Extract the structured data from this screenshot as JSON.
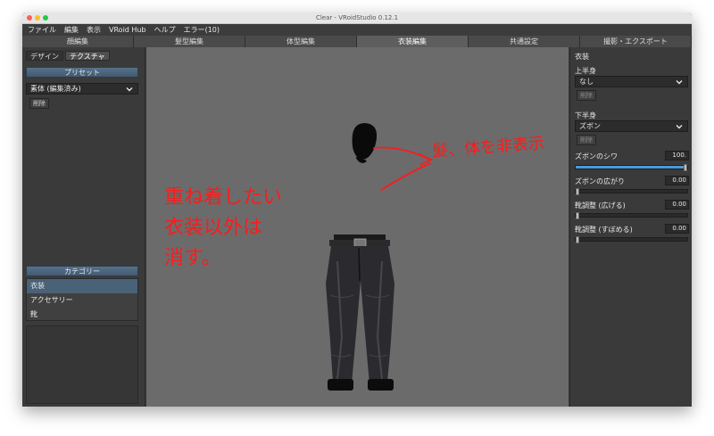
{
  "window": {
    "title": "Clear - VRoidStudio 0.12.1"
  },
  "menubar": [
    "ファイル",
    "編集",
    "表示",
    "VRoid Hub",
    "ヘルプ",
    "エラー(10)"
  ],
  "main_tabs": [
    "顔編集",
    "髪型編集",
    "体型編集",
    "衣装編集",
    "共通設定",
    "撮影・エクスポート"
  ],
  "active_main_tab": 3,
  "left": {
    "subtabs": [
      "デザイン",
      "テクスチャ"
    ],
    "preset_header": "プリセット",
    "preset_value": "素体 (編集済み)",
    "delete_label": "削除",
    "category_header": "カテゴリー",
    "categories": [
      "衣装",
      "アクセサリー",
      "靴"
    ]
  },
  "right": {
    "title": "衣装",
    "upper_label": "上半身",
    "upper_value": "なし",
    "upper_delete": "削除",
    "lower_label": "下半身",
    "lower_value": "ズボン",
    "lower_delete": "削除",
    "params": [
      {
        "label": "ズボンのシワ",
        "value": "100.",
        "fraction": 1.0
      },
      {
        "label": "ズボンの広がり",
        "value": "0.00",
        "fraction": 0.0
      },
      {
        "label": "靴調整 (広げる)",
        "value": "0.00",
        "fraction": 0.0
      },
      {
        "label": "靴調整 (すぼめる)",
        "value": "0.00",
        "fraction": 0.0
      }
    ]
  },
  "annotations": {
    "right_note": "髪、体を非表示",
    "left_note_lines": [
      "重ね着したい",
      "衣装以外は",
      "消す。"
    ]
  },
  "colors": {
    "annotation": "#ff1a1a",
    "accent": "#4a9ad6",
    "selected": "#4a6278"
  }
}
